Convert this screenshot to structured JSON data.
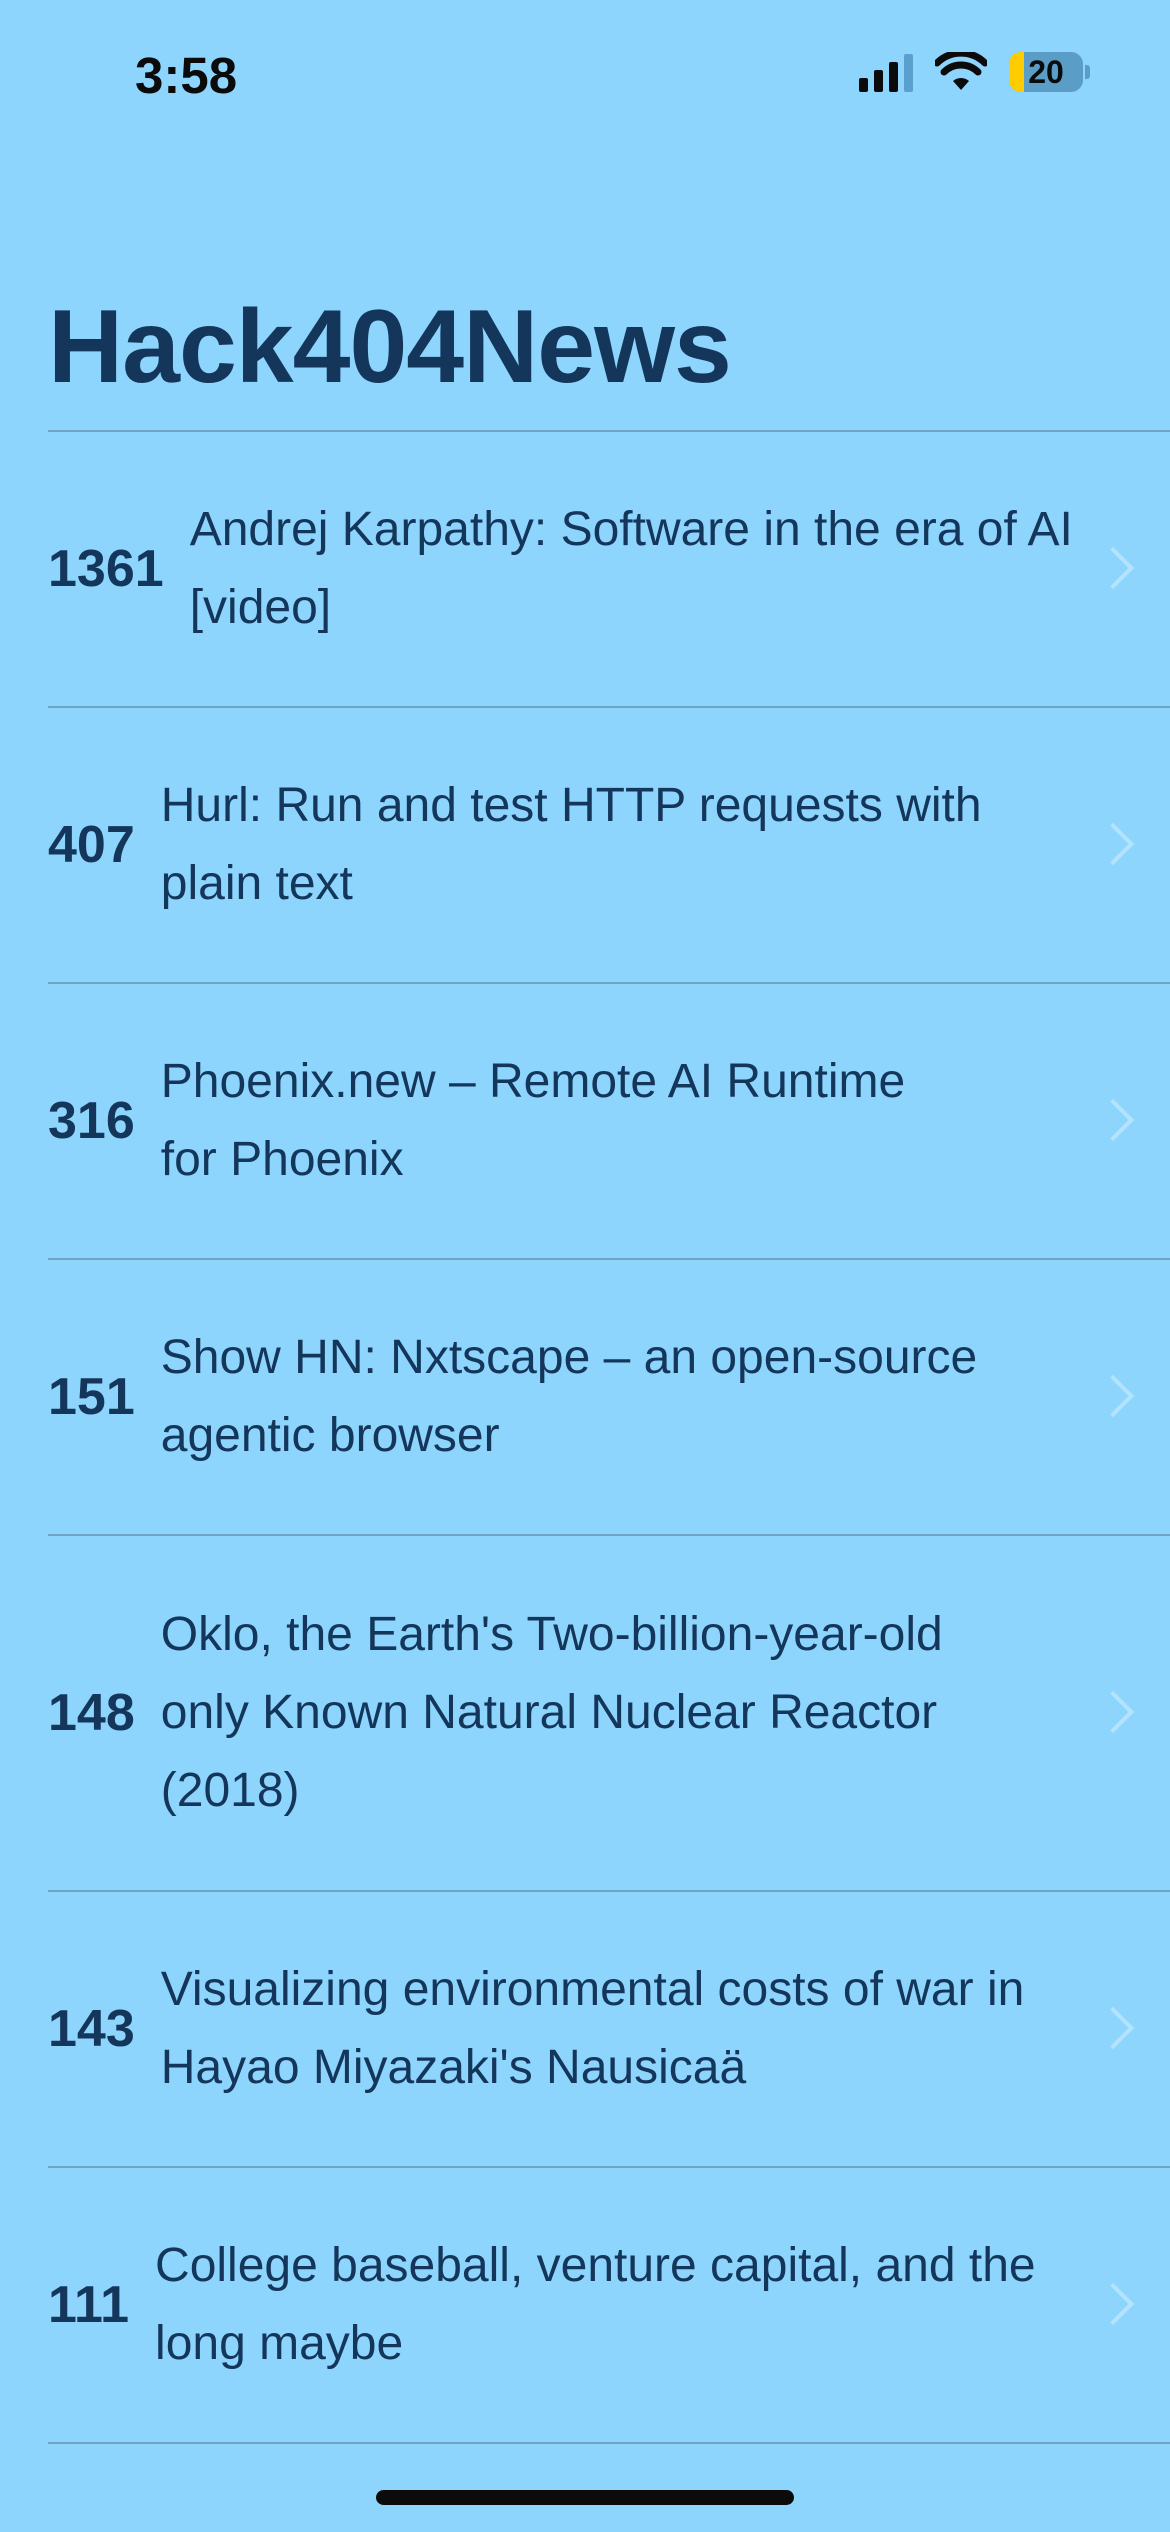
{
  "status_bar": {
    "time": "3:58",
    "battery": "20",
    "icons": [
      "cellular-signal-icon",
      "wifi-icon",
      "battery-icon"
    ]
  },
  "app": {
    "title": "Hack404News"
  },
  "stories": [
    {
      "points": "1361",
      "title": "Andrej Karpathy: Software in the era of AI [video]"
    },
    {
      "points": "407",
      "title": "Hurl: Run and test HTTP requests with plain text"
    },
    {
      "points": "316",
      "title": "Phoenix.new – Remote AI Runtime for Phoenix"
    },
    {
      "points": "151",
      "title": "Show HN: Nxtscape – an open-source agentic browser"
    },
    {
      "points": "148",
      "title": "Oklo, the Earth's Two-billion-year-old only Known Natural Nuclear Reactor (2018)"
    },
    {
      "points": "143",
      "title": "Visualizing environmental costs of war in Hayao Miyazaki's Nausicaä"
    },
    {
      "points": "111",
      "title": "College baseball, venture capital, and the long maybe"
    }
  ],
  "colors": {
    "background": "#8dd5fd",
    "text": "#14365a",
    "separator": "#6fa4c6",
    "chevron": "#b4e3fe"
  }
}
